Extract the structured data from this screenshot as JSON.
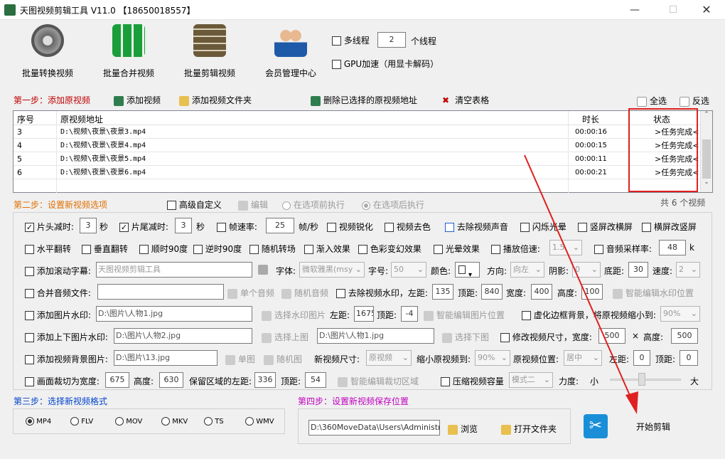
{
  "window": {
    "title": "天图视频剪辑工具 V11.0   【18650018557】"
  },
  "toolbar": [
    {
      "label": "批量转换视频"
    },
    {
      "label": "批量合并视频"
    },
    {
      "label": "批量剪辑视频"
    },
    {
      "label": "会员管理中心"
    }
  ],
  "thread": {
    "label": "多线程",
    "value": "2",
    "suffix": "个线程",
    "gpu": "GPU加速（用显卡解码）"
  },
  "step1": {
    "title": "第一步：添加原视频",
    "add_video": "添加视频",
    "add_folder": "添加视频文件夹",
    "delete": "删除已选择的原视频地址",
    "clear": "清空表格",
    "select_all": "全选",
    "invert": "反选"
  },
  "table": {
    "headers": [
      "序号",
      "原视频地址",
      "时长",
      "状态"
    ],
    "rows": [
      {
        "no": "3",
        "path": "D:\\视频\\夜景\\夜景3.mp4",
        "dur": "00:00:16",
        "status": ">任务完成<"
      },
      {
        "no": "4",
        "path": "D:\\视频\\夜景\\夜景4.mp4",
        "dur": "00:00:15",
        "status": ">任务完成<"
      },
      {
        "no": "5",
        "path": "D:\\视频\\夜景\\夜景5.mp4",
        "dur": "00:00:11",
        "status": ">任务完成<"
      },
      {
        "no": "6",
        "path": "D:\\视频\\夜景\\夜景6.mp4",
        "dur": "00:00:21",
        "status": ">任务完成<"
      }
    ],
    "count": "共 6 个视频"
  },
  "step2": {
    "title": "第二步：设置新视频选项",
    "advanced": "高级自定义",
    "edit": "编辑",
    "before": "在选项前执行",
    "after": "在选项后执行"
  },
  "r1": {
    "head_cut": "片头减时:",
    "head_val": "3",
    "sec": "秒",
    "tail_cut": "片尾减时:",
    "tail_val": "3",
    "sec2": "秒",
    "fps": "帧速率:",
    "fps_val": "25",
    "fps_unit": "帧/秒",
    "sharpen": "视频锐化",
    "decolor": "视频去色",
    "mute": "去除视频声音",
    "flash": "闪烁光晕",
    "v2h": "竖屏改横屏",
    "h2v": "横屏改竖屏"
  },
  "r2": {
    "hflip": "水平翻转",
    "vflip": "垂直翻转",
    "cw90": "顺时90度",
    "ccw90": "逆时90度",
    "random_tr": "随机转场",
    "fade_in": "渐入效果",
    "color": "色彩变幻效果",
    "halo": "光晕效果",
    "speed": "播放倍速:",
    "speed_val": "1.5",
    "sample": "音频采样率:",
    "sample_val": "48",
    "k": "k"
  },
  "r3": {
    "scroll": "添加滚动字幕:",
    "scroll_val": "天图视频剪辑工具",
    "font": "字体:",
    "font_val": "微软雅黑(msy",
    "size": "字号:",
    "size_val": "50",
    "color": "颜色:",
    "dir": "方向:",
    "dir_val": "向左",
    "shadow": "阴影:",
    "shadow_val": "0",
    "bottom": "底距:",
    "bottom_val": "30",
    "speed": "速度:",
    "speed_val": "2"
  },
  "r4": {
    "merge": "合并音频文件:",
    "single": "单个音频",
    "random": "随机音频",
    "rm_wm": "去除视频水印，左距:",
    "left_val": "135",
    "top": "顶距:",
    "top_val": "840",
    "width": "宽度:",
    "width_val": "400",
    "height": "高度:",
    "height_val": "100",
    "smart": "智能编辑水印位置"
  },
  "r5": {
    "img_wm": "添加图片水印:",
    "img_val": "D:\\图片\\人物1.jpg",
    "choose": "选择水印图片",
    "left": "左距:",
    "left_val": "1675",
    "top": "顶距:",
    "top_val": "-4",
    "smart": "智能编辑图片位置",
    "blur": "虚化边框背景，将原视频缩小到:",
    "blur_val": "90%"
  },
  "r6": {
    "ud": "添加上下图片水印:",
    "up_val": "D:\\图片\\人物2.jpg",
    "up_btn": "选择上图",
    "down_val": "D:\\图片\\人物1.jpg",
    "down_btn": "选择下图",
    "resize": "修改视频尺寸，宽度:",
    "w_val": "500",
    "x": "×",
    "h": "高度:",
    "h_val": "500"
  },
  "r7": {
    "bg": "添加视频背景图片:",
    "bg_val": "D:\\图片\\13.jpg",
    "single": "单图",
    "random": "随机图",
    "newsize": "新视频尺寸:",
    "newsize_val": "原视频",
    "shrink": "缩小原视频到:",
    "shrink_val": "90%",
    "pos": "原视频位置:",
    "pos_val": "居中",
    "left": "左距:",
    "left_val": "0",
    "top": "顶距:",
    "top_val": "0"
  },
  "r8": {
    "crop": "画面裁切为宽度:",
    "w_val": "675",
    "h": "高度:",
    "h_val": "630",
    "keep": "保留区域的左距:",
    "left_val": "336",
    "top": "顶距:",
    "top_val": "54",
    "smart": "智能编辑裁切区域",
    "compress": "压缩视频容量",
    "mode_val": "模式二",
    "strength": "力度:",
    "small": "小",
    "big": "大"
  },
  "step3": {
    "title": "第三步：选择新视频格式",
    "formats": [
      "MP4",
      "FLV",
      "MOV",
      "MKV",
      "TS",
      "WMV"
    ]
  },
  "step4": {
    "title": "第四步：设置新视频保存位置",
    "path": "D:\\360MoveData\\Users\\Administr",
    "browse": "浏览",
    "open": "打开文件夹",
    "start": "开始剪辑"
  }
}
